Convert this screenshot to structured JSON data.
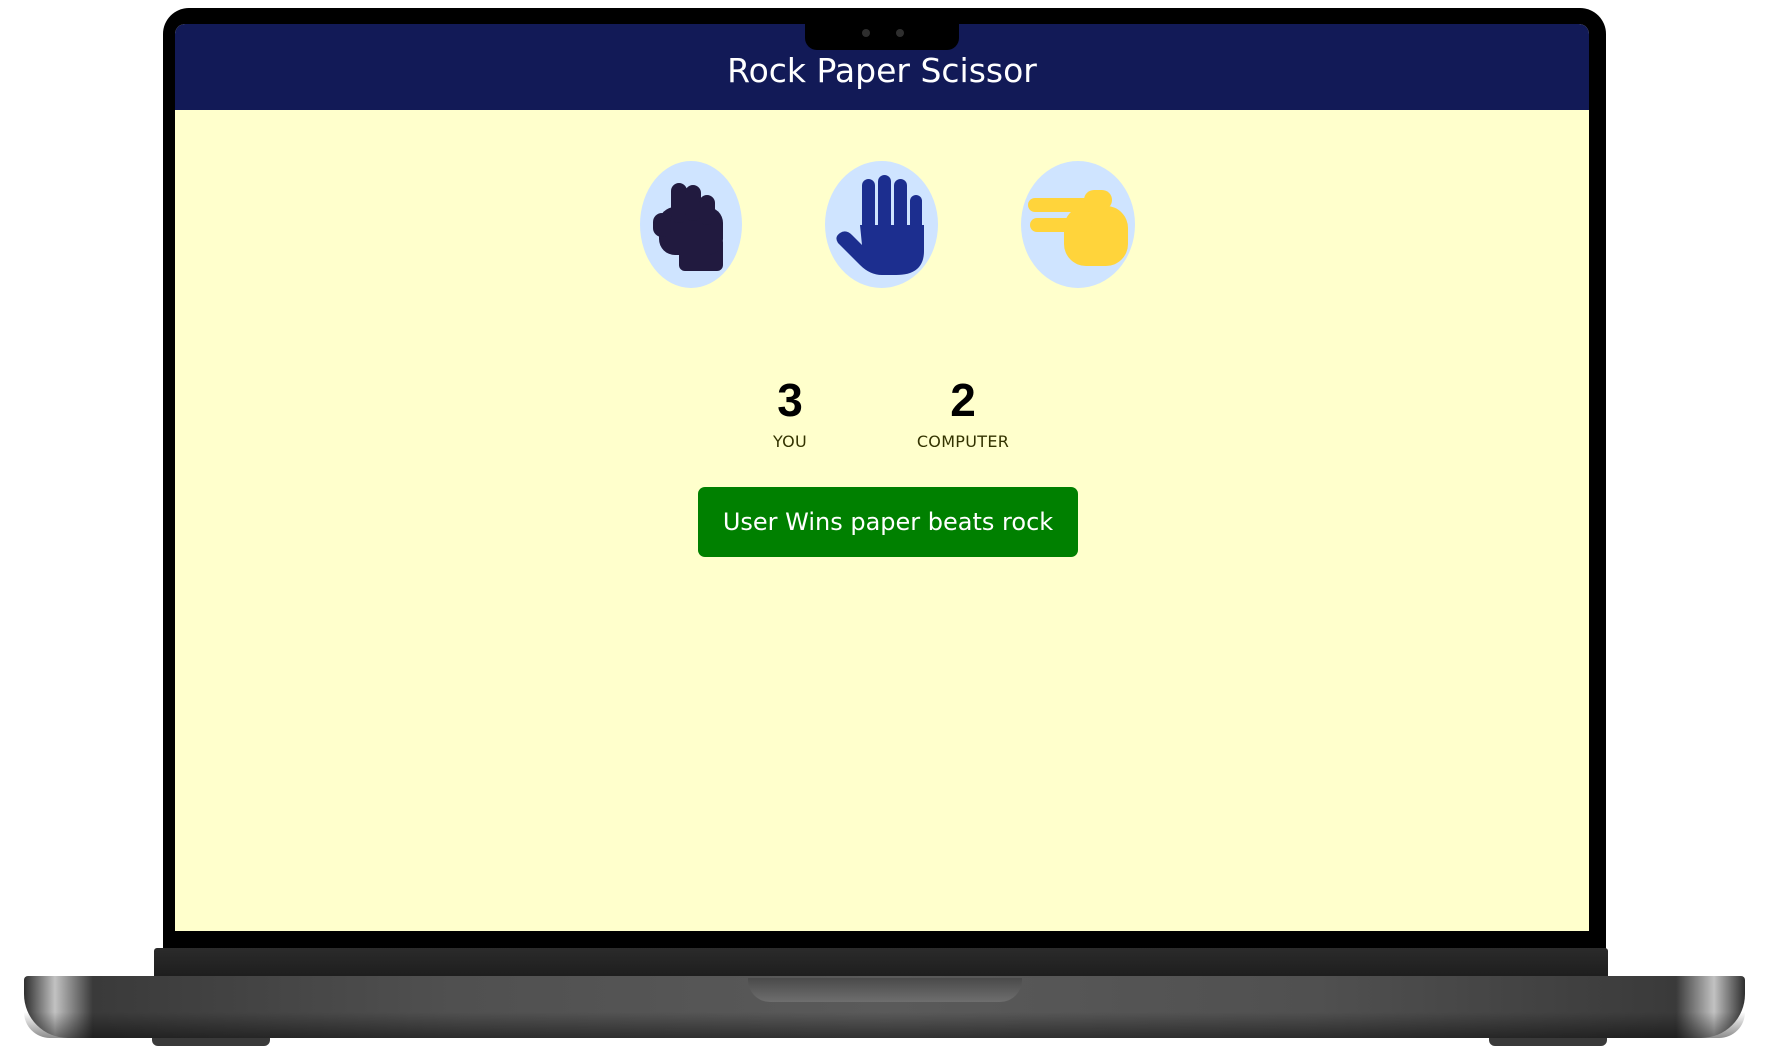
{
  "app": {
    "title": "Rock Paper Scissor"
  },
  "choices": [
    {
      "id": "rock",
      "icon": "rock-fist-icon",
      "color": "#211a3f"
    },
    {
      "id": "paper",
      "icon": "paper-hand-icon",
      "color": "#1c2e8f"
    },
    {
      "id": "scissors",
      "icon": "scissors-hand-icon",
      "color": "#ffd43b"
    }
  ],
  "scoreboard": {
    "user": {
      "score": "3",
      "label": "YOU"
    },
    "computer": {
      "score": "2",
      "label": "COMPUTER"
    }
  },
  "message": {
    "text": "User Wins paper beats rock",
    "color": "#008000"
  },
  "theme": {
    "navbar": "#121a57",
    "background": "#ffffcc",
    "choice_bg": "#cfe4ff"
  }
}
